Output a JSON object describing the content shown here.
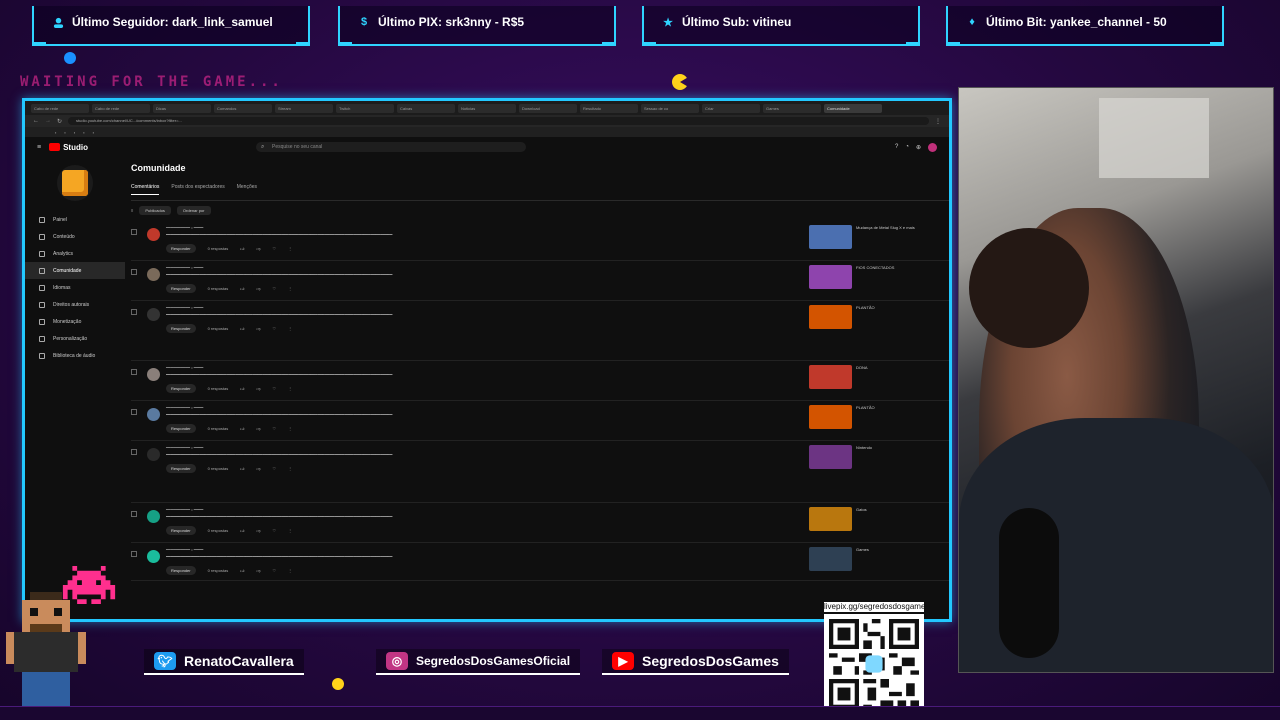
{
  "overlay": {
    "stats": [
      {
        "label": "Último Seguidor: dark_link_samuel",
        "icon": "person-icon"
      },
      {
        "label": "Último PIX: srk3nny - R$5",
        "icon": "dollar-icon"
      },
      {
        "label": "Último Sub: vitineu",
        "icon": "star-icon"
      },
      {
        "label": "Último Bit: yankee_channel - 50",
        "icon": "diamond-icon"
      }
    ],
    "waiting": "WAITING FOR THE GAME...",
    "socials": [
      {
        "label": "RenatoCavallera",
        "icon": "twitter-icon"
      },
      {
        "label": "SegredosDosGamesOficial",
        "icon": "instagram-icon"
      },
      {
        "label": "SegredosDosGames",
        "icon": "youtube-icon"
      }
    ],
    "qr_url": "livepix.gg/segredosdosgames",
    "colors": {
      "accent": "#23c8ff",
      "magenta": "#ff2fa0",
      "bg": "#2a0a4a"
    }
  },
  "browser": {
    "url": "studio.youtube.com/channel/UC.../comments/inbox?filter=...",
    "tabs": [
      "Cabo de rede",
      "Cabo de rede",
      "Dicas",
      "Comandos",
      "Stream",
      "Twitch",
      "Caixas",
      "Noticias",
      "Download",
      "Resultado",
      "Sessao de co",
      "Criar",
      "Games",
      "Criar",
      "Comunidade"
    ]
  },
  "studio": {
    "brand": "Studio",
    "search_placeholder": "Pesquise no seu canal",
    "nav": [
      "Painel",
      "Conteúdo",
      "Analytics",
      "Comunidade",
      "Idiomas",
      "Direitos autorais",
      "Monetização",
      "Personalização",
      "Biblioteca de áudio"
    ],
    "page_title": "Comunidade",
    "subtabs": [
      "Comentários",
      "Posts dos espectadores",
      "Menções"
    ],
    "filters": [
      "Publicados",
      "Ordenar por"
    ],
    "reply_label": "Responder",
    "replies_label": "0 respostas",
    "comments": [
      {
        "avatar_color": "#c0392b",
        "video_thumb": "#4b6fb0",
        "video_title": "Mudança de Metal Slug X e mais"
      },
      {
        "avatar_color": "#7a6a5a",
        "video_thumb": "#8e44ad",
        "video_title": "FIOS CONECTADOS"
      },
      {
        "avatar_color": "#333333",
        "video_thumb": "#d35400",
        "video_title": "PLANTÃO"
      },
      {
        "avatar_color": "#8a7f7a",
        "video_thumb": "#c0392b",
        "video_title": "DONA"
      },
      {
        "avatar_color": "#5a7aa0",
        "video_thumb": "#d35400",
        "video_title": "PLANTÃO"
      },
      {
        "avatar_color": "#2a2a2a",
        "video_thumb": "#6c3483",
        "video_title": "Nintendo"
      },
      {
        "avatar_color": "#16a085",
        "video_thumb": "#b9770e",
        "video_title": "Gatos"
      },
      {
        "avatar_color": "#1abc9c",
        "video_thumb": "#2e4053",
        "video_title": "Games"
      }
    ]
  }
}
